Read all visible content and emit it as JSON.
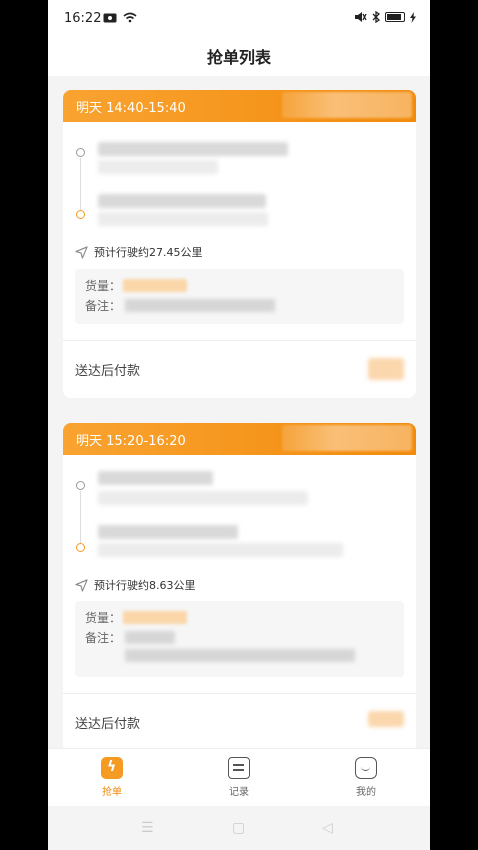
{
  "status_bar": {
    "time": "16:22"
  },
  "header": {
    "title": "抢单列表"
  },
  "orders": [
    {
      "time": "明天 14:40-15:40",
      "distance": "预计行驶约27.45公里",
      "cargo_label": "货量：",
      "remark_label": "备注：",
      "payment": "送达后付款"
    },
    {
      "time": "明天 15:20-16:20",
      "distance": "预计行驶约8.63公里",
      "cargo_label": "货量：",
      "remark_label": "备注：",
      "payment": "送达后付款"
    }
  ],
  "tabbar": {
    "tabs": [
      {
        "label": "抢单",
        "icon": "lightning-icon",
        "active": true
      },
      {
        "label": "记录",
        "icon": "calendar-icon",
        "active": false
      },
      {
        "label": "我的",
        "icon": "smile-icon",
        "active": false
      }
    ]
  },
  "colors": {
    "accent": "#f28b0c",
    "accent_light": "#f9a331"
  }
}
